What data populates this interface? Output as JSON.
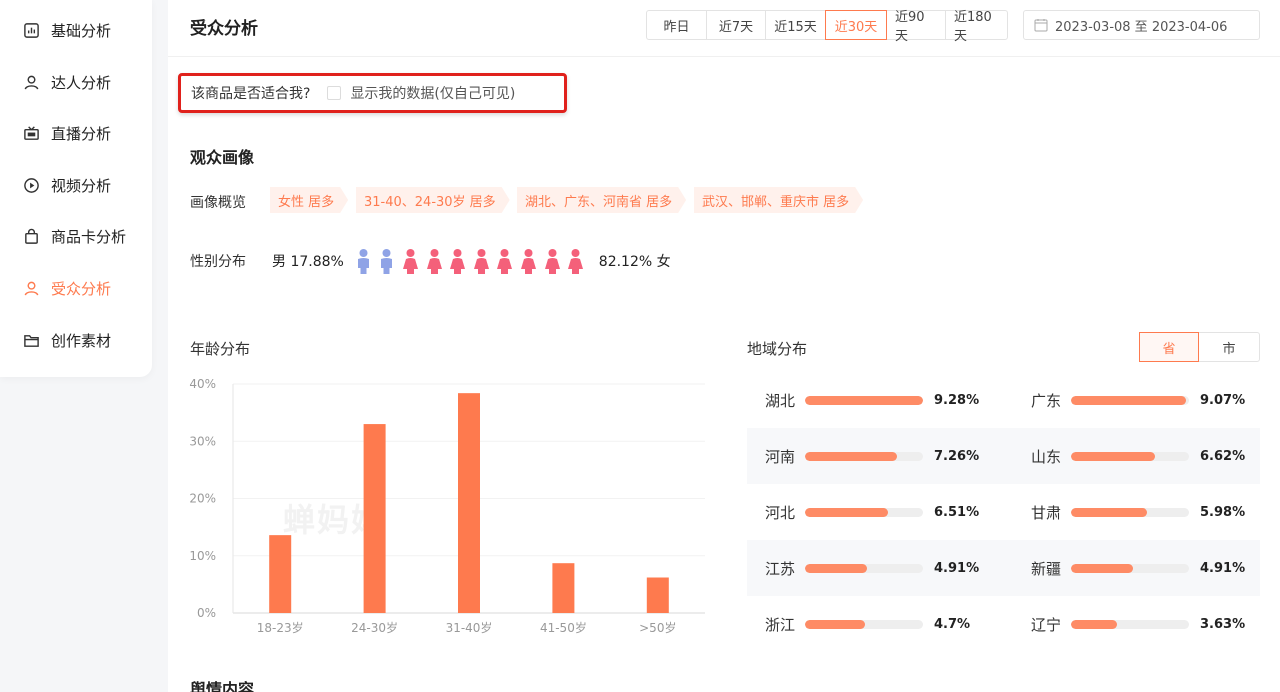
{
  "sidebar": {
    "items": [
      {
        "label": "基础分析",
        "icon": "bar-chart-icon",
        "active": false
      },
      {
        "label": "达人分析",
        "icon": "user-icon",
        "active": false
      },
      {
        "label": "直播分析",
        "icon": "live-icon",
        "active": false
      },
      {
        "label": "视频分析",
        "icon": "play-icon",
        "active": false
      },
      {
        "label": "商品卡分析",
        "icon": "bag-icon",
        "active": false
      },
      {
        "label": "受众分析",
        "icon": "audience-icon",
        "active": true
      },
      {
        "label": "创作素材",
        "icon": "folder-icon",
        "active": false
      }
    ]
  },
  "header": {
    "title": "受众分析",
    "ranges": [
      "昨日",
      "近7天",
      "近15天",
      "近30天",
      "近90天",
      "近180天"
    ],
    "active_range": "近30天",
    "date_range": "2023-03-08 至 2023-04-06"
  },
  "fit": {
    "question": "该商品是否适合我?",
    "checkbox_label": "显示我的数据(仅自己可见)",
    "checked": false
  },
  "portrait": {
    "title": "观众画像",
    "overview_label": "画像概览",
    "tags": [
      "女性 居多",
      "31-40、24-30岁 居多",
      "湖北、广东、河南省 居多",
      "武汉、邯郸、重庆市 居多"
    ],
    "gender_label": "性别分布",
    "male_text": "男 17.88%",
    "female_text": "82.12% 女",
    "male_icons": 2,
    "female_icons": 8,
    "male_color": "#8fa3e6",
    "female_color": "#f4607a"
  },
  "age": {
    "title": "年龄分布",
    "watermark": "蝉妈妈"
  },
  "chart_data": {
    "type": "bar",
    "categories": [
      "18-23岁",
      "24-30岁",
      "31-40岁",
      "41-50岁",
      ">50岁"
    ],
    "values": [
      13.6,
      33.0,
      38.4,
      8.7,
      6.2
    ],
    "ylim": [
      0,
      40
    ],
    "yticks": [
      "0%",
      "10%",
      "20%",
      "30%",
      "40%"
    ],
    "color": "#fe7a4e"
  },
  "region": {
    "title": "地域分布",
    "toggle": [
      "省",
      "市"
    ],
    "active_toggle": "省",
    "rows": [
      [
        {
          "name": "湖北",
          "pct": "9.28%",
          "value": 9.28
        },
        {
          "name": "广东",
          "pct": "9.07%",
          "value": 9.07
        }
      ],
      [
        {
          "name": "河南",
          "pct": "7.26%",
          "value": 7.26
        },
        {
          "name": "山东",
          "pct": "6.62%",
          "value": 6.62
        }
      ],
      [
        {
          "name": "河北",
          "pct": "6.51%",
          "value": 6.51
        },
        {
          "name": "甘肃",
          "pct": "5.98%",
          "value": 5.98
        }
      ],
      [
        {
          "name": "江苏",
          "pct": "4.91%",
          "value": 4.91
        },
        {
          "name": "新疆",
          "pct": "4.91%",
          "value": 4.91
        }
      ],
      [
        {
          "name": "浙江",
          "pct": "4.7%",
          "value": 4.7
        },
        {
          "name": "辽宁",
          "pct": "3.63%",
          "value": 3.63
        }
      ]
    ]
  },
  "sentiment": {
    "title": "舆情内容"
  }
}
